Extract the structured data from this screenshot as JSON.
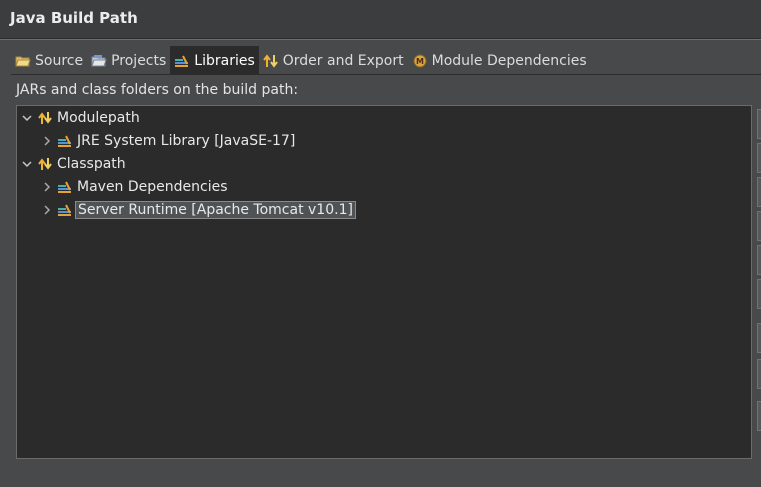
{
  "window": {
    "title": "Java Build Path"
  },
  "tabs": [
    {
      "label": "Source",
      "icon": "source-folder-icon"
    },
    {
      "label": "Projects",
      "icon": "projects-folder-icon"
    },
    {
      "label": "Libraries",
      "icon": "library-icon",
      "active": true
    },
    {
      "label": "Order and Export",
      "icon": "order-export-icon"
    },
    {
      "label": "Module Dependencies",
      "icon": "module-icon"
    }
  ],
  "description": "JARs and class folders on the build path:",
  "tree": {
    "items": [
      {
        "label": "Modulepath",
        "icon": "classpath-container-icon",
        "expanded": true,
        "level": 0
      },
      {
        "label": "JRE System Library [JavaSE-17]",
        "icon": "library-icon",
        "expanded": false,
        "level": 1
      },
      {
        "label": "Classpath",
        "icon": "classpath-container-icon",
        "expanded": true,
        "level": 0
      },
      {
        "label": "Maven Dependencies",
        "icon": "library-icon",
        "expanded": false,
        "level": 1
      },
      {
        "label": "Server Runtime [Apache Tomcat v10.1]",
        "icon": "library-icon",
        "expanded": false,
        "level": 1,
        "selected": true
      }
    ]
  },
  "colors": {
    "background": "#47494b",
    "tree_background": "#2b2b2b",
    "selection": "#505355",
    "text": "#e8e8e8"
  }
}
